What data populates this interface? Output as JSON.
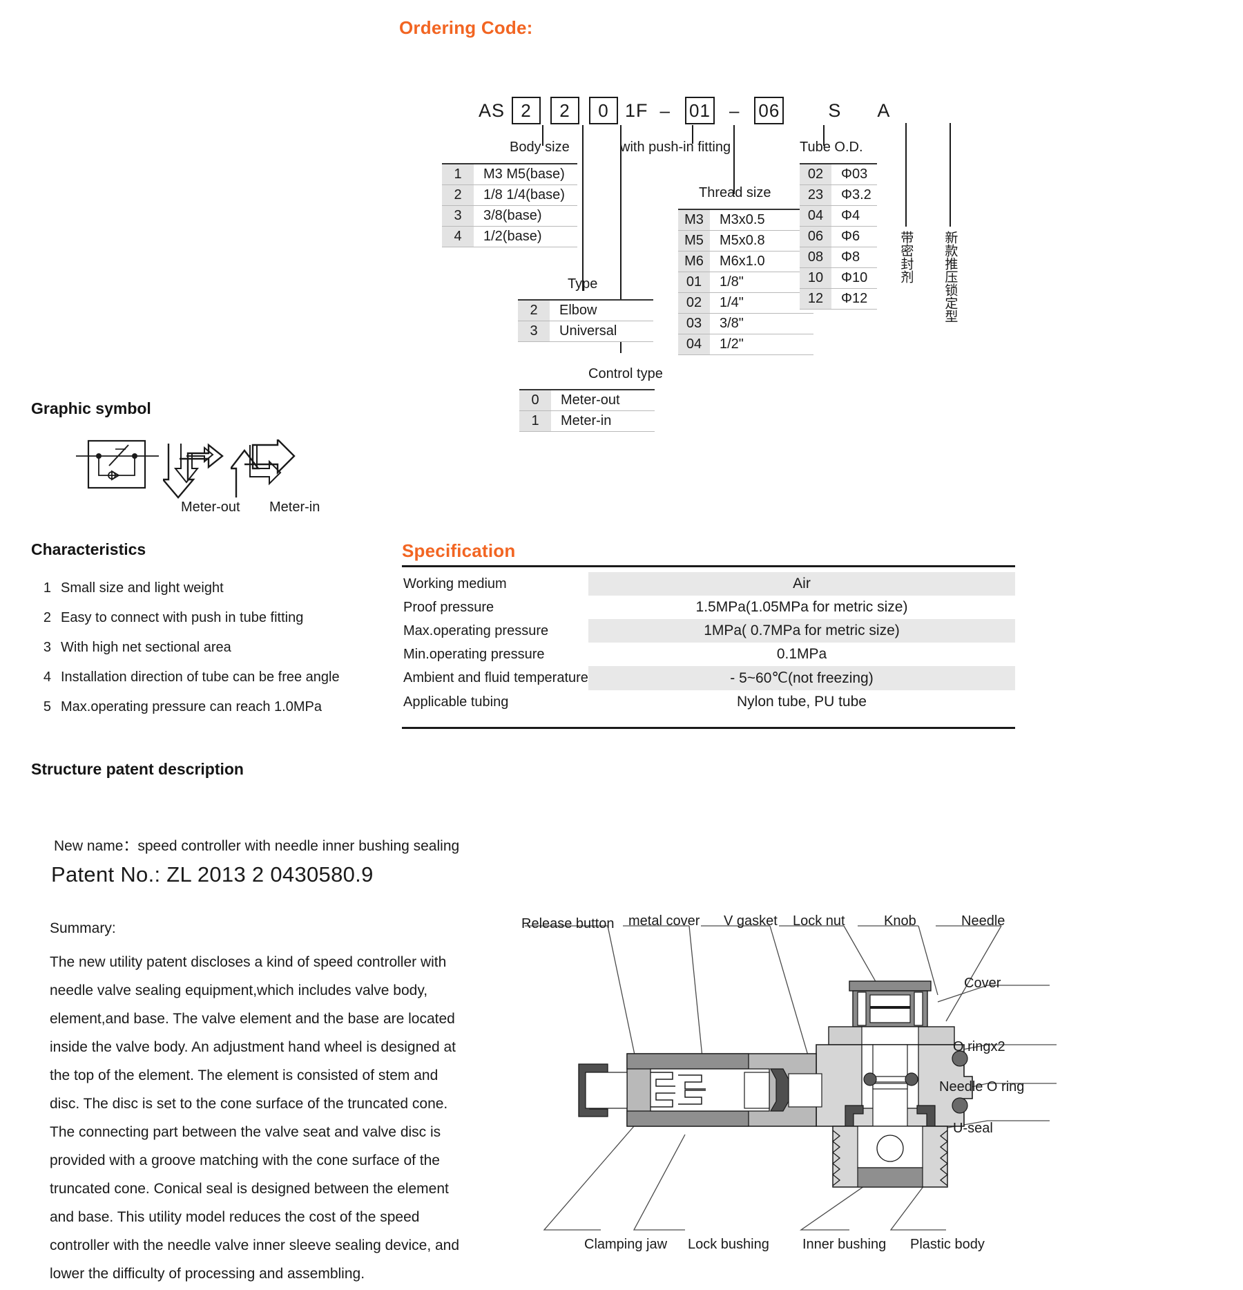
{
  "headings": {
    "ordering_code": "Ordering Code:",
    "graphic_symbol": "Graphic symbol",
    "characteristics": "Characteristics",
    "specification": "Specification",
    "structure_patent": "Structure patent description"
  },
  "ordering_code": {
    "segments": [
      {
        "text": "AS",
        "boxed": false
      },
      {
        "text": "2",
        "boxed": true
      },
      {
        "text": "2",
        "boxed": true
      },
      {
        "text": "0",
        "boxed": true
      },
      {
        "text": "1F",
        "boxed": false
      },
      {
        "text": "–",
        "boxed": false
      },
      {
        "text": "01",
        "boxed": true
      },
      {
        "text": "–",
        "boxed": false
      },
      {
        "text": "06",
        "boxed": true
      },
      {
        "text": "S",
        "boxed": false
      },
      {
        "text": "A",
        "boxed": false
      }
    ],
    "callouts": {
      "body_size": "Body size",
      "type": "Type",
      "control_type": "Control type",
      "push_in_fitting": "with push-in fitting",
      "thread_size": "Thread size",
      "tube_od": "Tube O.D.",
      "sealant_cjk": "带密封剂",
      "push_lock_cjk": "新款推压锁定型"
    },
    "body_size_table": [
      {
        "code": "1",
        "desc": "M3 M5(base)"
      },
      {
        "code": "2",
        "desc": "1/8 1/4(base)"
      },
      {
        "code": "3",
        "desc": "3/8(base)"
      },
      {
        "code": "4",
        "desc": "1/2(base)"
      }
    ],
    "type_table": [
      {
        "code": "2",
        "desc": "Elbow"
      },
      {
        "code": "3",
        "desc": "Universal"
      }
    ],
    "control_type_table": [
      {
        "code": "0",
        "desc": "Meter-out"
      },
      {
        "code": "1",
        "desc": "Meter-in"
      }
    ],
    "thread_size_table": [
      {
        "code": "M3",
        "desc": "M3x0.5"
      },
      {
        "code": "M5",
        "desc": "M5x0.8"
      },
      {
        "code": "M6",
        "desc": "M6x1.0"
      },
      {
        "code": "01",
        "desc": "1/8\""
      },
      {
        "code": "02",
        "desc": "1/4\""
      },
      {
        "code": "03",
        "desc": "3/8\""
      },
      {
        "code": "04",
        "desc": "1/2\""
      }
    ],
    "tube_od_table": [
      {
        "code": "02",
        "desc": "Φ03"
      },
      {
        "code": "23",
        "desc": "Φ3.2"
      },
      {
        "code": "04",
        "desc": "Φ4"
      },
      {
        "code": "06",
        "desc": "Φ6"
      },
      {
        "code": "08",
        "desc": "Φ8"
      },
      {
        "code": "10",
        "desc": "Φ10"
      },
      {
        "code": "12",
        "desc": "Φ12"
      }
    ]
  },
  "graphic_symbol": {
    "meter_out": "Meter-out",
    "meter_in": "Meter-in"
  },
  "characteristics": [
    {
      "num": "1",
      "text": "Small size and light weight"
    },
    {
      "num": "2",
      "text": "Easy to connect with push in tube fitting"
    },
    {
      "num": "3",
      "text": "With high net sectional area"
    },
    {
      "num": "4",
      "text": "Installation direction of tube can be free angle"
    },
    {
      "num": "5",
      "text": "Max.operating pressure can reach 1.0MPa"
    }
  ],
  "specification": [
    {
      "label": "Working medium",
      "value": "Air",
      "shaded": true
    },
    {
      "label": "Proof pressure",
      "value": "1.5MPa(1.05MPa for metric size)",
      "shaded": false
    },
    {
      "label": "Max.operating pressure",
      "value": "1MPa( 0.7MPa for metric size)",
      "shaded": true
    },
    {
      "label": "Min.operating pressure",
      "value": "0.1MPa",
      "shaded": false
    },
    {
      "label": "Ambient and fluid temperature",
      "value": "- 5~60℃(not freezing)",
      "shaded": true
    },
    {
      "label": "Applicable tubing",
      "value": "Nylon tube, PU tube",
      "shaded": false
    }
  ],
  "patent": {
    "new_name": "New name：speed controller with needle inner bushing sealing",
    "patent_no": "Patent No.: ZL 2013 2 0430580.9",
    "summary_label": "Summary:",
    "summary_lines": [
      "The new utility patent discloses a kind of speed controller with",
      "needle valve sealing equipment,which includes valve body,",
      "element,and base. The valve element and the base are located",
      "inside the valve body. An adjustment hand wheel is designed at",
      "the top of the element. The element is consisted of stem and",
      "disc. The disc is set to the cone surface of the truncated cone.",
      "The connecting part between the valve seat and valve disc is",
      "provided with a groove matching with the cone surface of the",
      "truncated cone. Conical seal is designed between the element",
      "and base. This utility model reduces the cost of the speed",
      "controller with the needle valve inner sleeve sealing device, and",
      "lower the difficulty of processing and assembling."
    ]
  },
  "diagram_labels": {
    "top": [
      "Release button",
      "metal cover",
      "V gasket",
      "Lock nut",
      "Knob",
      "Needle"
    ],
    "right": [
      "Cover",
      "O ringx2",
      "Needle O ring",
      "U-seal"
    ],
    "bottom": [
      "Clamping jaw",
      "Lock bushing",
      "Inner bushing",
      "Plastic body"
    ]
  },
  "colors": {
    "accent_orange": "#F26522",
    "text": "#1a1a1a",
    "table_key_bg": "#e3e3e3",
    "spec_shade": "#e8e8e8"
  }
}
